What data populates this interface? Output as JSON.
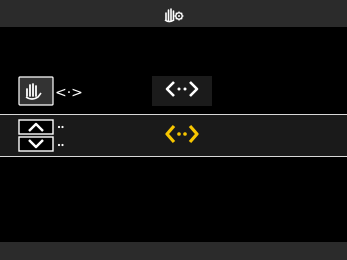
{
  "screen": {
    "header_icon": "hand-gear-icon",
    "menu": [
      {
        "icon": "touch-gesture-arrows-icon",
        "value_icon": "left-right-arrows-icon",
        "selected": false
      },
      {
        "icon": "up-down-arrows-box-icon",
        "value_icon": "left-right-arrows-icon",
        "selected": true
      }
    ]
  },
  "colors": {
    "background": "#000000",
    "bar": "#2b2b2b",
    "text": "#ffffff",
    "accent": "#f7c600"
  }
}
